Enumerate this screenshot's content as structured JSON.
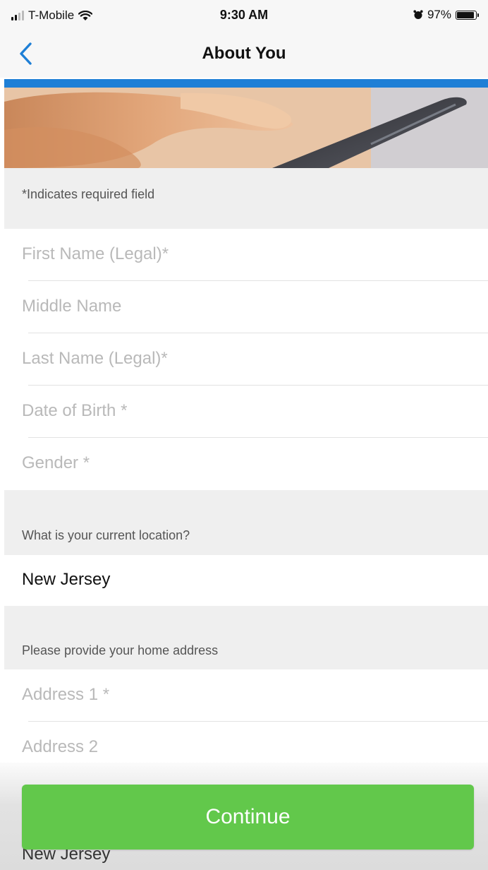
{
  "status_bar": {
    "carrier": "T-Mobile",
    "time": "9:30 AM",
    "battery": "97%"
  },
  "nav": {
    "title": "About You"
  },
  "colors": {
    "accent": "#1e7fd6",
    "continue_button": "#62c84b"
  },
  "form": {
    "required_note": "*Indicates required field",
    "fields": [
      {
        "placeholder": "First Name (Legal)*"
      },
      {
        "placeholder": "Middle Name"
      },
      {
        "placeholder": "Last Name (Legal)*"
      },
      {
        "placeholder": "Date of Birth *"
      },
      {
        "placeholder": "Gender *"
      }
    ],
    "location": {
      "prompt": "What is your current location?",
      "value": "New Jersey"
    },
    "address": {
      "prompt": "Please provide your home address",
      "fields": [
        {
          "placeholder": "Address 1 *"
        },
        {
          "placeholder": "Address 2"
        }
      ],
      "state_value": "New Jersey"
    }
  },
  "actions": {
    "continue_label": "Continue"
  }
}
